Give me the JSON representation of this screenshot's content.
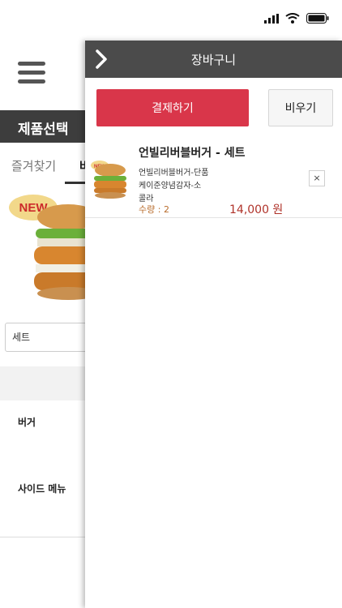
{
  "background": {
    "section_title": "제품선택",
    "tabs": {
      "favorites": "즐겨찾기",
      "burger_partial": "버"
    },
    "promo_badge": "NEW",
    "select_value": "세트",
    "menu_rows": [
      "버거",
      "사이드 메뉴"
    ]
  },
  "cart_panel": {
    "title": "장바구니",
    "pay_label": "결제하기",
    "clear_label": "비우기",
    "item": {
      "badge": "NEW",
      "name": "언빌리버블버거 - 세트",
      "options": [
        "언빌리버블버거-단품",
        "케이준양념감자-소",
        "콜라"
      ],
      "quantity": "수량 : 2",
      "price": "14,000 원",
      "remove_symbol": "×"
    }
  },
  "colors": {
    "pay_button": "#d9364a",
    "header": "#4b4b4b",
    "section_bar": "#3d3d3d"
  }
}
